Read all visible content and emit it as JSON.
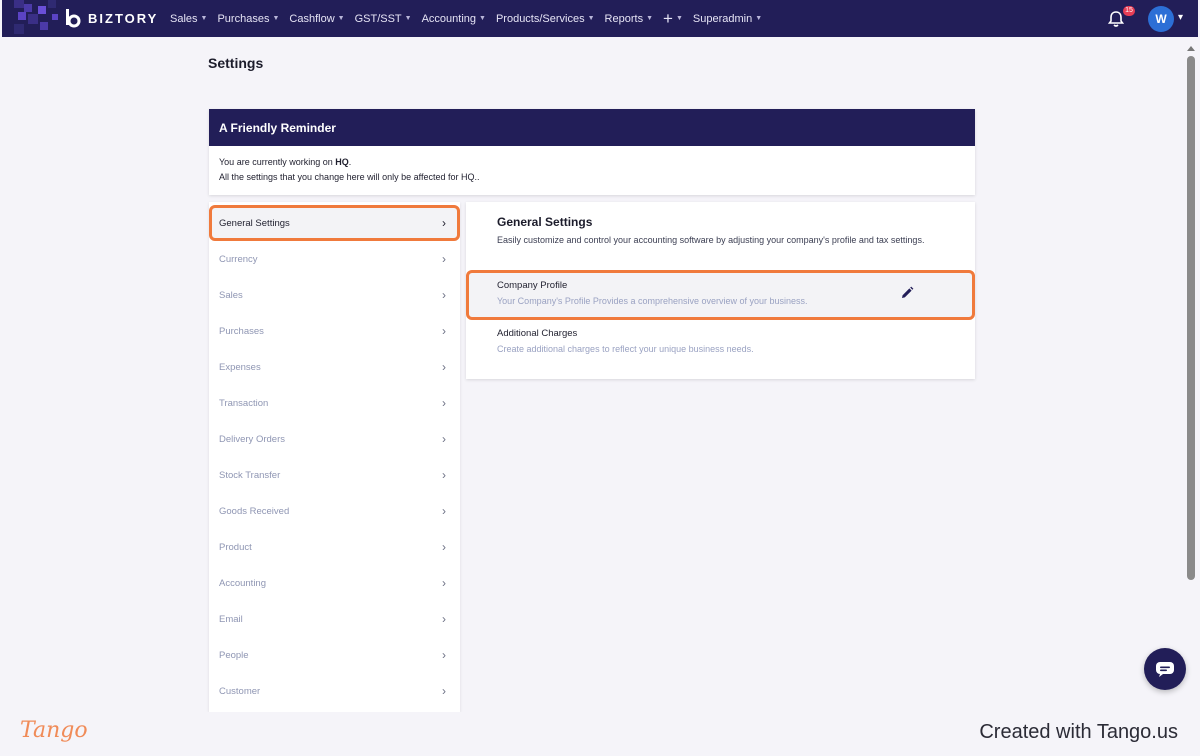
{
  "app": {
    "brand": "BIZTORY",
    "accent_color": "#221e58",
    "highlight_color": "#f07a3c"
  },
  "nav": {
    "items": [
      {
        "label": "Sales",
        "icon": "chevron-down-icon"
      },
      {
        "label": "Purchases",
        "icon": "chevron-down-icon"
      },
      {
        "label": "Cashflow",
        "icon": "chevron-down-icon"
      },
      {
        "label": "GST/SST",
        "icon": "chevron-down-icon"
      },
      {
        "label": "Accounting",
        "icon": "chevron-down-icon"
      },
      {
        "label": "Products/Services",
        "icon": "chevron-down-icon"
      },
      {
        "label": "Reports",
        "icon": "chevron-down-icon"
      }
    ],
    "plus_icon": "plus-icon",
    "superadmin": "Superadmin",
    "notifications_count": "15",
    "avatar_initial": "W"
  },
  "page": {
    "title": "Settings"
  },
  "reminder": {
    "title": "A Friendly Reminder",
    "line1_prefix": "You are currently working on ",
    "line1_branch": "HQ",
    "line1_suffix": ".",
    "line2": "All the settings that you change here will only be affected for HQ.."
  },
  "sidebar": {
    "items": [
      {
        "label": "General Settings",
        "active": true
      },
      {
        "label": "Currency"
      },
      {
        "label": "Sales"
      },
      {
        "label": "Purchases"
      },
      {
        "label": "Expenses"
      },
      {
        "label": "Transaction"
      },
      {
        "label": "Delivery Orders"
      },
      {
        "label": "Stock Transfer"
      },
      {
        "label": "Goods Received"
      },
      {
        "label": "Product"
      },
      {
        "label": "Accounting"
      },
      {
        "label": "Email"
      },
      {
        "label": "People"
      },
      {
        "label": "Customer"
      }
    ]
  },
  "panel": {
    "title": "General Settings",
    "description": "Easily customize and control your accounting software by adjusting your company's profile and tax settings.",
    "options": [
      {
        "title": "Company Profile",
        "description": "Your Company's Profile Provides a comprehensive overview of your business.",
        "icon": "pencil-icon"
      },
      {
        "title": "Additional Charges",
        "description": "Create additional charges to reflect your unique business needs."
      }
    ]
  },
  "footer": {
    "logo": "Tango",
    "created_with": "Created with Tango.us"
  }
}
